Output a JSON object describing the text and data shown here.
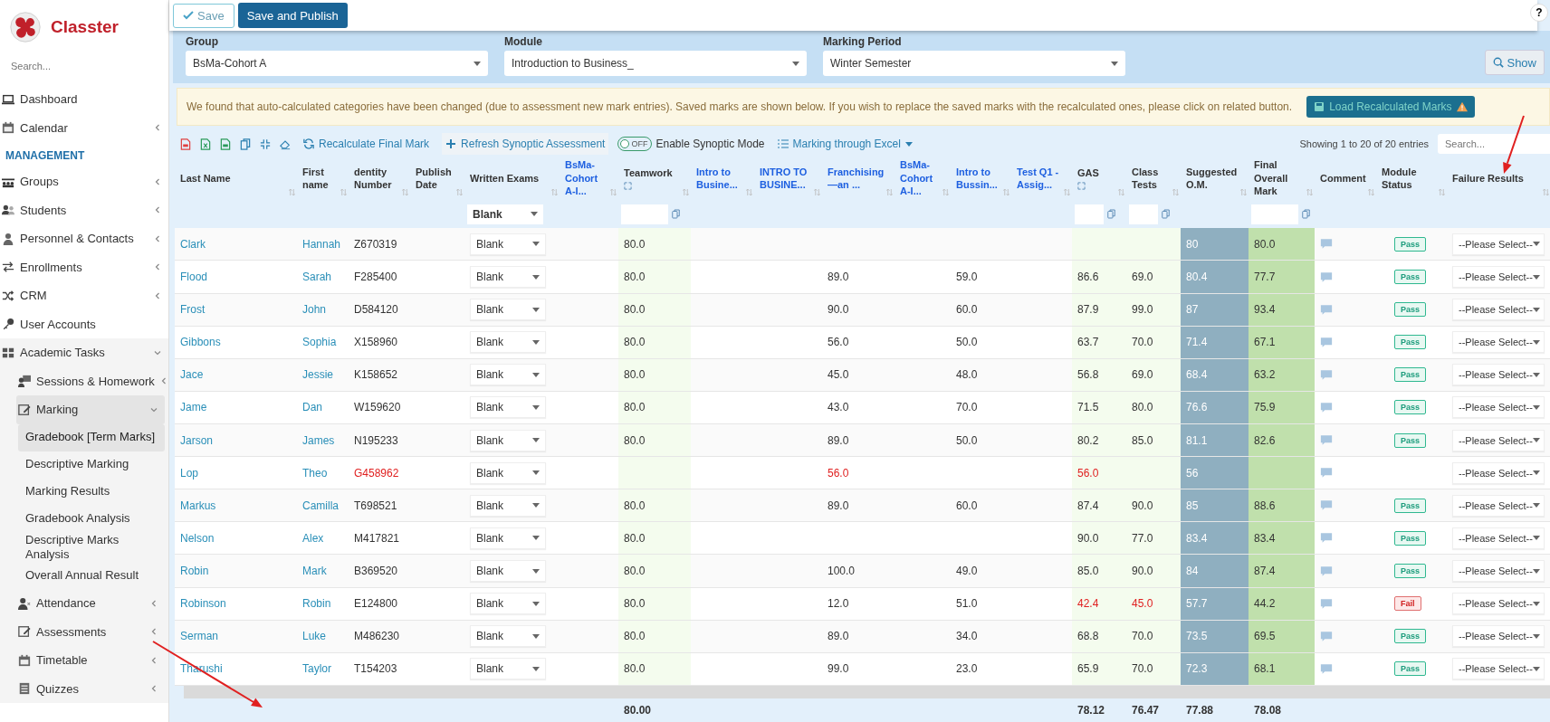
{
  "sidebar": {
    "brand": "Classter",
    "search": {
      "placeholder": "Search..."
    },
    "items": [
      {
        "kind": "item",
        "label": "Dashboard",
        "has_submenu": false
      },
      {
        "kind": "item",
        "label": "Calendar",
        "has_submenu": true,
        "expanded": false
      },
      {
        "kind": "section",
        "label": "MANAGEMENT"
      },
      {
        "kind": "item",
        "label": "Groups",
        "has_submenu": true,
        "expanded": false
      },
      {
        "kind": "item",
        "label": "Students",
        "has_submenu": true,
        "expanded": false
      },
      {
        "kind": "item",
        "label": "Personnel & Contacts",
        "has_submenu": true,
        "expanded": false
      },
      {
        "kind": "item",
        "label": "Enrollments",
        "has_submenu": true,
        "expanded": false
      },
      {
        "kind": "item",
        "label": "CRM",
        "has_submenu": true,
        "expanded": false
      },
      {
        "kind": "item",
        "label": "User Accounts",
        "has_submenu": false
      },
      {
        "kind": "item",
        "label": "Academic Tasks",
        "has_submenu": true,
        "expanded": true,
        "children": [
          {
            "label": "Sessions & Homework",
            "has_submenu": true,
            "expanded": false,
            "selected": false
          },
          {
            "label": "Marking",
            "has_submenu": true,
            "expanded": true,
            "selected": true,
            "children": [
              {
                "label": "Gradebook [Term Marks]",
                "selected": true
              },
              {
                "label": "Descriptive Marking",
                "selected": false
              },
              {
                "label": "Marking Results",
                "selected": false
              },
              {
                "label": "Gradebook Analysis",
                "selected": false
              },
              {
                "label": "Descriptive Marks Analysis",
                "selected": false
              },
              {
                "label": "Overall Annual Result",
                "selected": false
              }
            ]
          },
          {
            "label": "Attendance",
            "has_submenu": true,
            "expanded": false,
            "selected": false
          },
          {
            "label": "Assessments",
            "has_submenu": true,
            "expanded": false,
            "selected": false
          },
          {
            "label": "Timetable",
            "has_submenu": true,
            "expanded": false,
            "selected": false
          },
          {
            "label": "Quizzes",
            "has_submenu": true,
            "expanded": false,
            "selected": false
          }
        ]
      }
    ]
  },
  "toolbar": {
    "save": "Save",
    "save_publish": "Save and Publish",
    "help": "?"
  },
  "filters": [
    {
      "label": "Group",
      "value": "BsMa-Cohort A"
    },
    {
      "label": "Module",
      "value": "Introduction to Business_"
    },
    {
      "label": "Marking Period",
      "value": "Winter Semester"
    }
  ],
  "show_button": "Show",
  "alert": {
    "text": "We found that auto-calculated categories have been changed (due to assessment new mark entries). Saved marks are shown below. If you wish to replace the saved marks with the recalculated ones, please click on related button.",
    "button": "Load Recalculated Marks"
  },
  "table_tools": {
    "recalculate": "Recalculate Final Mark",
    "refresh": "Refresh Synoptic Assessment",
    "synoptic_toggle": {
      "on": false,
      "state_text": "OFF",
      "label": "Enable Synoptic Mode"
    },
    "excel": "Marking through Excel",
    "entries": "Showing 1 to 20 of 20 entries",
    "search_placeholder": "Search..."
  },
  "columns": [
    {
      "label": "Last Name",
      "link": false,
      "expand": false
    },
    {
      "label": "First name",
      "link": false,
      "expand": false
    },
    {
      "label": "dentity Number",
      "link": false,
      "expand": false
    },
    {
      "label": "Publish Date",
      "link": false,
      "expand": false
    },
    {
      "label": "Written Exams",
      "link": false,
      "expand": false,
      "filter": {
        "kind": "select",
        "value": "Blank"
      }
    },
    {
      "label": "BsMa-Cohort A-I...",
      "link": true,
      "expand": false
    },
    {
      "label": "Teamwork",
      "link": false,
      "expand": true,
      "filter": {
        "kind": "input"
      }
    },
    {
      "label": "Intro to Busine...",
      "link": true,
      "expand": false
    },
    {
      "label": "INTRO TO BUSINE...",
      "link": true,
      "expand": false
    },
    {
      "label": "Franchising —an ...",
      "link": true,
      "expand": false
    },
    {
      "label": "BsMa-Cohort A-I...",
      "link": true,
      "expand": false
    },
    {
      "label": "Intro to Bussin...",
      "link": true,
      "expand": false
    },
    {
      "label": "Test Q1 - Assig...",
      "link": true,
      "expand": false
    },
    {
      "label": "GAS",
      "link": false,
      "expand": true,
      "filter": {
        "kind": "input"
      }
    },
    {
      "label": "Class Tests",
      "link": false,
      "expand": false,
      "filter": {
        "kind": "input"
      }
    },
    {
      "label": "Suggested O.M.",
      "link": false,
      "expand": false
    },
    {
      "label": "Final Overall Mark",
      "link": false,
      "expand": false,
      "filter": {
        "kind": "input"
      }
    },
    {
      "label": "Comment",
      "link": false,
      "expand": false
    },
    {
      "label": "Module Status",
      "link": false,
      "expand": false
    },
    {
      "label": "Failure Results",
      "link": false,
      "expand": false
    }
  ],
  "rows": [
    {
      "last_name": "Clark",
      "first_name": "Hannah",
      "identity_number": "Z670319",
      "written_exams": "Blank",
      "teamwork": "80.0",
      "suggested_om": "80",
      "final_overall_mark": "80.0",
      "module_status": {
        "text": "Pass",
        "passed": true
      },
      "failure_results": "--Please Select--",
      "identity_warning": false,
      "gas_warning": false,
      "class_tests_warning": false
    },
    {
      "last_name": "Flood",
      "first_name": "Sarah",
      "identity_number": "F285400",
      "written_exams": "Blank",
      "teamwork": "80.0",
      "franchising": "89.0",
      "intro_to_bussin": "59.0",
      "gas": "86.6",
      "class_tests": "69.0",
      "suggested_om": "80.4",
      "final_overall_mark": "77.7",
      "module_status": {
        "text": "Pass",
        "passed": true
      },
      "failure_results": "--Please Select--",
      "identity_warning": false,
      "franchising_warning": false,
      "gas_warning": false,
      "class_tests_warning": false
    },
    {
      "last_name": "Frost",
      "first_name": "John",
      "identity_number": "D584120",
      "written_exams": "Blank",
      "teamwork": "80.0",
      "franchising": "90.0",
      "intro_to_bussin": "60.0",
      "gas": "87.9",
      "class_tests": "99.0",
      "suggested_om": "87",
      "final_overall_mark": "93.4",
      "module_status": {
        "text": "Pass",
        "passed": true
      },
      "failure_results": "--Please Select--",
      "identity_warning": false,
      "franchising_warning": false,
      "gas_warning": false,
      "class_tests_warning": false
    },
    {
      "last_name": "Gibbons",
      "first_name": "Sophia",
      "identity_number": "X158960",
      "written_exams": "Blank",
      "teamwork": "80.0",
      "franchising": "56.0",
      "intro_to_bussin": "50.0",
      "gas": "63.7",
      "class_tests": "70.0",
      "suggested_om": "71.4",
      "final_overall_mark": "67.1",
      "module_status": {
        "text": "Pass",
        "passed": true
      },
      "failure_results": "--Please Select--",
      "identity_warning": false,
      "franchising_warning": false,
      "gas_warning": false,
      "class_tests_warning": false
    },
    {
      "last_name": "Jace",
      "first_name": "Jessie",
      "identity_number": "K158652",
      "written_exams": "Blank",
      "teamwork": "80.0",
      "franchising": "45.0",
      "intro_to_bussin": "48.0",
      "gas": "56.8",
      "class_tests": "69.0",
      "suggested_om": "68.4",
      "final_overall_mark": "63.2",
      "module_status": {
        "text": "Pass",
        "passed": true
      },
      "failure_results": "--Please Select--",
      "identity_warning": false,
      "franchising_warning": false,
      "gas_warning": false,
      "class_tests_warning": false
    },
    {
      "last_name": "Jame",
      "first_name": "Dan",
      "identity_number": "W159620",
      "written_exams": "Blank",
      "teamwork": "80.0",
      "franchising": "43.0",
      "intro_to_bussin": "70.0",
      "gas": "71.5",
      "class_tests": "80.0",
      "suggested_om": "76.6",
      "final_overall_mark": "75.9",
      "module_status": {
        "text": "Pass",
        "passed": true
      },
      "failure_results": "--Please Select--",
      "identity_warning": false,
      "franchising_warning": false,
      "gas_warning": false,
      "class_tests_warning": false
    },
    {
      "last_name": "Jarson",
      "first_name": "James",
      "identity_number": "N195233",
      "written_exams": "Blank",
      "teamwork": "80.0",
      "franchising": "89.0",
      "intro_to_bussin": "50.0",
      "gas": "80.2",
      "class_tests": "85.0",
      "suggested_om": "81.1",
      "final_overall_mark": "82.6",
      "module_status": {
        "text": "Pass",
        "passed": true
      },
      "failure_results": "--Please Select--",
      "identity_warning": false,
      "franchising_warning": false,
      "gas_warning": false,
      "class_tests_warning": false
    },
    {
      "last_name": "Lop",
      "first_name": "Theo",
      "identity_number": "G458962",
      "written_exams": "Blank",
      "franchising": "56.0",
      "gas": "56.0",
      "suggested_om": "56",
      "failure_results": "--Please Select--",
      "identity_warning": true,
      "franchising_warning": true,
      "gas_warning": true,
      "class_tests_warning": false
    },
    {
      "last_name": "Markus",
      "first_name": "Camilla",
      "identity_number": "T698521",
      "written_exams": "Blank",
      "teamwork": "80.0",
      "franchising": "89.0",
      "intro_to_bussin": "60.0",
      "gas": "87.4",
      "class_tests": "90.0",
      "suggested_om": "85",
      "final_overall_mark": "88.6",
      "module_status": {
        "text": "Pass",
        "passed": true
      },
      "failure_results": "--Please Select--",
      "identity_warning": false,
      "franchising_warning": false,
      "gas_warning": false,
      "class_tests_warning": false
    },
    {
      "last_name": "Nelson",
      "first_name": "Alex",
      "identity_number": "M417821",
      "written_exams": "Blank",
      "teamwork": "80.0",
      "gas": "90.0",
      "class_tests": "77.0",
      "suggested_om": "83.4",
      "final_overall_mark": "83.4",
      "module_status": {
        "text": "Pass",
        "passed": true
      },
      "failure_results": "--Please Select--",
      "identity_warning": false,
      "gas_warning": false,
      "class_tests_warning": false
    },
    {
      "last_name": "Robin",
      "first_name": "Mark",
      "identity_number": "B369520",
      "written_exams": "Blank",
      "teamwork": "80.0",
      "franchising": "100.0",
      "intro_to_bussin": "49.0",
      "gas": "85.0",
      "class_tests": "90.0",
      "suggested_om": "84",
      "final_overall_mark": "87.4",
      "module_status": {
        "text": "Pass",
        "passed": true
      },
      "failure_results": "--Please Select--",
      "identity_warning": false,
      "franchising_warning": false,
      "gas_warning": false,
      "class_tests_warning": false
    },
    {
      "last_name": "Robinson",
      "first_name": "Robin",
      "identity_number": "E124800",
      "written_exams": "Blank",
      "teamwork": "80.0",
      "franchising": "12.0",
      "intro_to_bussin": "51.0",
      "gas": "42.4",
      "class_tests": "45.0",
      "suggested_om": "57.7",
      "final_overall_mark": "44.2",
      "module_status": {
        "text": "Fail",
        "passed": false
      },
      "failure_results": "--Please Select--",
      "identity_warning": false,
      "franchising_warning": false,
      "gas_warning": true,
      "class_tests_warning": true
    },
    {
      "last_name": "Serman",
      "first_name": "Luke",
      "identity_number": "M486230",
      "written_exams": "Blank",
      "teamwork": "80.0",
      "franchising": "89.0",
      "intro_to_bussin": "34.0",
      "gas": "68.8",
      "class_tests": "70.0",
      "suggested_om": "73.5",
      "final_overall_mark": "69.5",
      "module_status": {
        "text": "Pass",
        "passed": true
      },
      "failure_results": "--Please Select--",
      "identity_warning": false,
      "franchising_warning": false,
      "gas_warning": false,
      "class_tests_warning": false
    },
    {
      "last_name": "Tharushi",
      "first_name": "Taylor",
      "identity_number": "T154203",
      "written_exams": "Blank",
      "teamwork": "80.0",
      "franchising": "99.0",
      "intro_to_bussin": "23.0",
      "gas": "65.9",
      "class_tests": "70.0",
      "suggested_om": "72.3",
      "final_overall_mark": "68.1",
      "module_status": {
        "text": "Pass",
        "passed": true
      },
      "failure_results": "--Please Select--",
      "identity_warning": false,
      "franchising_warning": false,
      "gas_warning": false,
      "class_tests_warning": false
    }
  ],
  "totals": {
    "teamwork": "80.00",
    "gas": "78.12",
    "class_tests": "76.47",
    "suggested_om": "77.88",
    "final_overall_mark": "78.08"
  }
}
